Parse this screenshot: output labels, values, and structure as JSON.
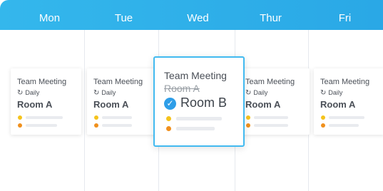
{
  "days": [
    "Mon",
    "Tue",
    "Wed",
    "Thur",
    "Fri"
  ],
  "cards": [
    {
      "title": "Team Meeting",
      "repeat": "Daily",
      "room": "Room A"
    },
    {
      "title": "Team Meeting",
      "repeat": "Daily",
      "room": "Room A"
    },
    {
      "title": "Team Meeting",
      "repeat": "Daily",
      "room": "Room A"
    },
    {
      "title": "Team Meeting",
      "repeat": "Daily",
      "room": "Room A"
    }
  ],
  "highlighted": {
    "title": "Team Meeting",
    "old_room": "Room A",
    "new_room": "Room B"
  },
  "colors": {
    "header": "#2aa8e6",
    "highlight_border": "#42baf0",
    "check": "#2e9ee8",
    "dot_yellow": "#f5c31c",
    "dot_orange": "#f0901d"
  },
  "icons": {
    "repeat": "repeat-icon",
    "check": "check-circle-icon"
  }
}
